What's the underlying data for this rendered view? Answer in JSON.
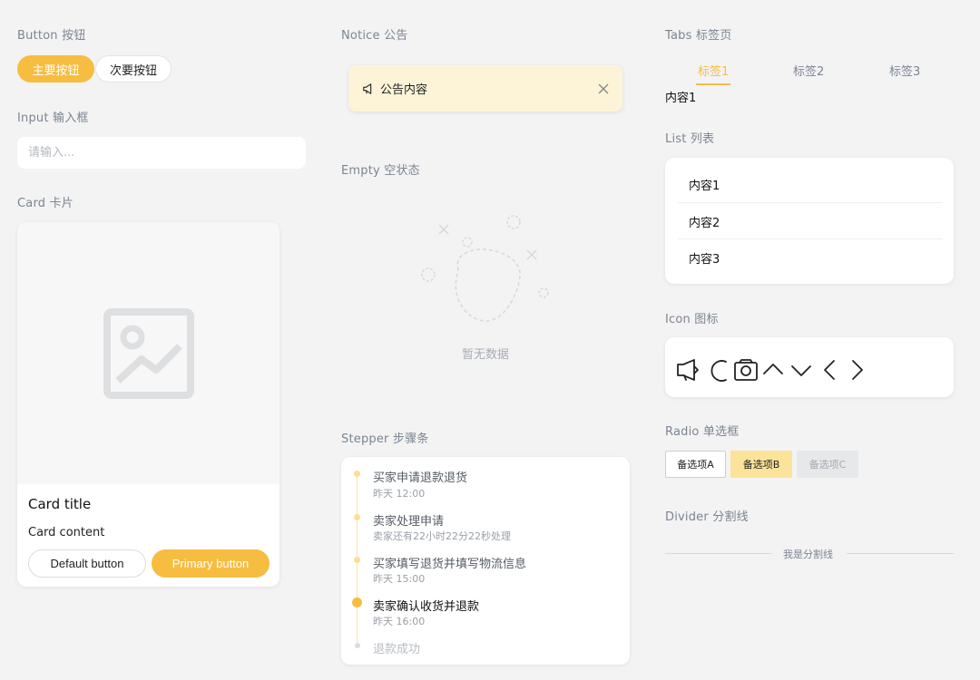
{
  "button": {
    "title": "Button 按钮",
    "primary_label": "主要按钮",
    "secondary_label": "次要按钮"
  },
  "input": {
    "title": "Input 输入框",
    "placeholder": "请输入..."
  },
  "card": {
    "title": "Card 卡片",
    "image_icon": "image-placeholder-icon",
    "card_title": "Card title",
    "card_content": "Card content",
    "default_button": "Default button",
    "primary_button": "Primary button"
  },
  "notice": {
    "title": "Notice 公告",
    "text": "公告内容",
    "icon": "megaphone-icon",
    "close_icon": "close-icon"
  },
  "empty": {
    "title": "Empty 空状态",
    "text": "暂无数据"
  },
  "stepper": {
    "title": "Stepper 步骤条",
    "steps": [
      {
        "title": "买家申请退款退货",
        "sub": "昨天 12:00"
      },
      {
        "title": "卖家处理申请",
        "sub": "卖家还有22小时22分22秒处理"
      },
      {
        "title": "买家填写退货并填写物流信息",
        "sub": "昨天 15:00"
      },
      {
        "title": "卖家确认收货并退款",
        "sub": "昨天 16:00"
      },
      {
        "title": "退款成功",
        "sub": ""
      }
    ]
  },
  "tabs": {
    "title": "Tabs 标签页",
    "items": [
      "标签1",
      "标签2",
      "标签3"
    ],
    "panel": "内容1"
  },
  "list": {
    "title": "List 列表",
    "items": [
      "内容1",
      "内容2",
      "内容3"
    ]
  },
  "icon": {
    "title": "Icon 图标",
    "icons": [
      "megaphone-icon",
      "loading-icon",
      "camera-icon",
      "chevron-up-icon",
      "chevron-down-icon",
      "chevron-left-icon",
      "chevron-right-icon"
    ]
  },
  "radio": {
    "title": "Radio 单选框",
    "options": [
      "备选项A",
      "备选项B",
      "备选项C"
    ]
  },
  "divider": {
    "title": "Divider 分割线",
    "text": "我是分割线"
  },
  "colors": {
    "accent": "#f6bd41",
    "notice_bg": "#fdf4d8",
    "page_bg": "#f3f3f4"
  }
}
